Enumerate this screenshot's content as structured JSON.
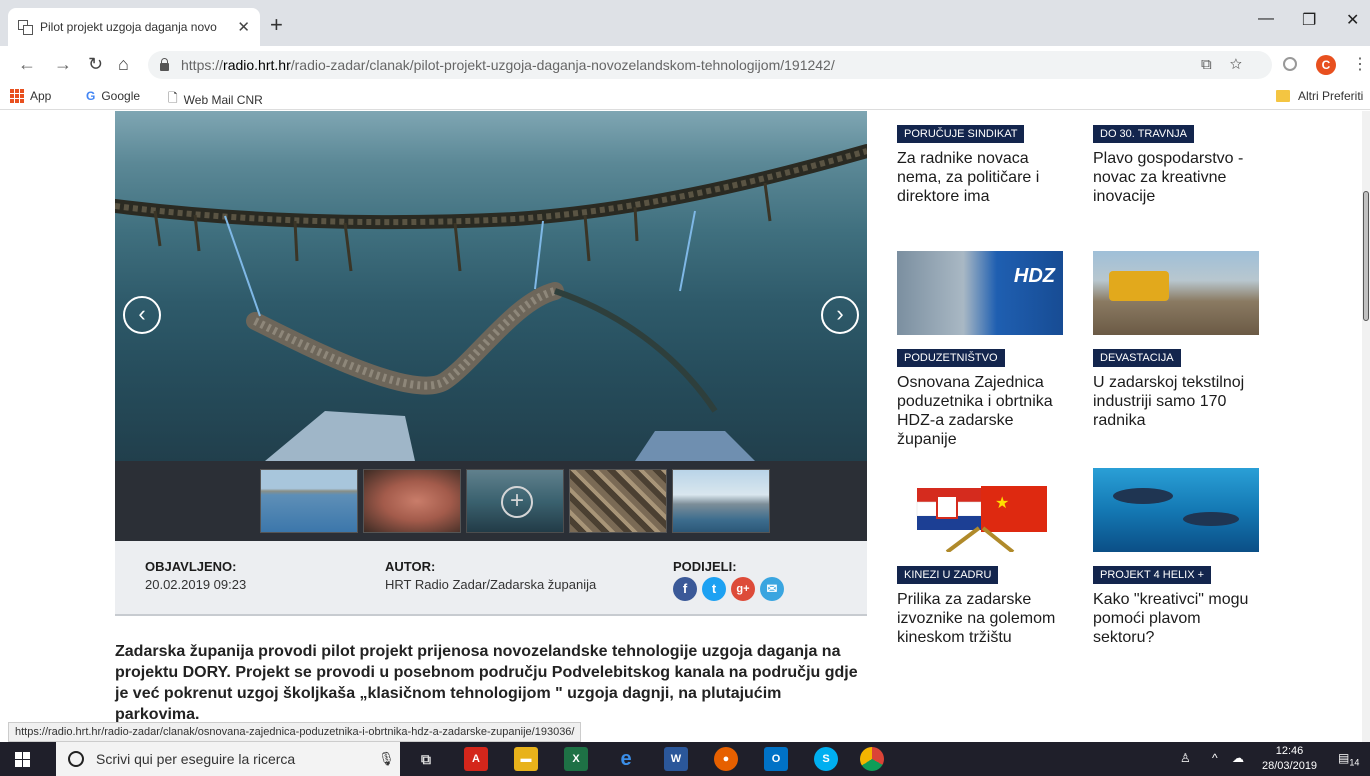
{
  "browser": {
    "tab_title": "Pilot projekt uzgoja daganja novo",
    "tab_close": "✕",
    "new_tab": "+",
    "url_scheme": "https://",
    "url_host": "radio.hrt.hr",
    "url_path": "/radio-zadar/clanak/pilot-projekt-uzgoja-daganja-novozelandskom-tehnologijom/191242/",
    "profile_initial": "C",
    "bookmarks": [
      "App",
      "Google",
      "Web Mail CNR"
    ],
    "other_bookmarks": "Altri Preferiti"
  },
  "gallery": {
    "prev_icon": "‹",
    "next_icon": "›",
    "thumb_count": 5,
    "active_thumb": 3
  },
  "meta": {
    "published_label": "OBJAVLJENO",
    "published_value": "20.02.2019 09:23",
    "author_label": "AUTOR",
    "author_value": "HRT Radio Zadar/Zadarska županija",
    "share_label": "PODIJELI",
    "share": [
      {
        "name": "facebook",
        "glyph": "f",
        "color": "#3b5998"
      },
      {
        "name": "twitter",
        "glyph": "t",
        "color": "#1da1f2"
      },
      {
        "name": "googleplus",
        "glyph": "g+",
        "color": "#dd4b39"
      },
      {
        "name": "email",
        "glyph": "✉",
        "color": "#3aa5e0"
      }
    ]
  },
  "article": {
    "lead": "Zadarska županija provodi pilot projekt prijenosa novozelandske tehnologije uzgoja daganja na projektu DORY. Projekt se provodi u posebnom području Podvelebitskog kanala na području gdje je već pokrenut uzgoj školjkaša „klasičnom tehnologijom \" uzgoja dagnji, na plutajućim parkovima."
  },
  "related": [
    {
      "tag": "PORUČUJE SINDIKAT",
      "title": "Za radnike novaca nema, za političare i direktore ima"
    },
    {
      "tag": "DO 30. TRAVNJA",
      "title": "Plavo gospodarstvo - novac za kreativne inovacije"
    },
    {
      "tag": "PODUZETNIŠTVO",
      "title": "Osnovana Zajednica poduzetnika i obrtnika HDZ-a zadarske županije"
    },
    {
      "tag": "DEVASTACIJA",
      "title": "U zadarskoj tekstilnoj industriji samo 170 radnika"
    },
    {
      "tag": "KINEZI U ZADRU",
      "title": "Prilika za zadarske izvoznike na golemom kineskom tržištu"
    },
    {
      "tag": "PROJEKT 4 HELIX +",
      "title": "Kako \"kreativci\" mogu pomoći plavom sektoru?"
    }
  ],
  "status_url": "https://radio.hrt.hr/radio-zadar/clanak/osnovana-zajednica-poduzetnika-i-obrtnika-hdz-a-zadarske-zupanije/193036/",
  "taskbar": {
    "search_placeholder": "Scrivi qui per eseguire la ricerca",
    "time": "12:46",
    "date": "28/03/2019",
    "notifications": "14"
  }
}
